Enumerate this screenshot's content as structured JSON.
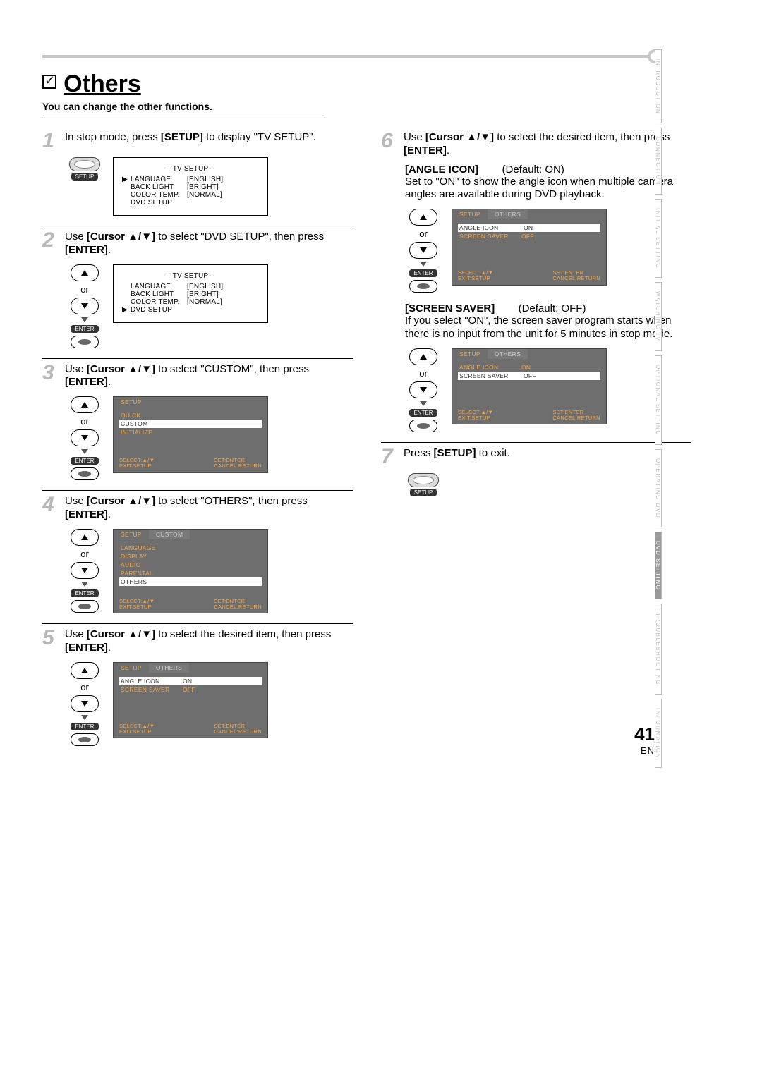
{
  "page": {
    "number": "41",
    "lang": "EN"
  },
  "title": "Others",
  "subtitle": "You can change the other functions.",
  "side_tabs": [
    "INTRODUCTION",
    "CONNECTION",
    "INITIAL SETTING",
    "WATCHING TV",
    "OPTIONAL SETTING",
    "OPERATING DVD",
    "DVD SETTING",
    "TROUBLESHOOTING",
    "INFORMATION"
  ],
  "active_tab_index": 6,
  "step1": {
    "text_before": "In stop mode, press ",
    "bold": "[SETUP]",
    "text_after": " to display \"TV SETUP\".",
    "panel_title": "–  TV SETUP  –",
    "rows": [
      {
        "ptr": "▶",
        "lab": "LANGUAGE",
        "val": "[ENGLISH]"
      },
      {
        "ptr": "",
        "lab": "BACK LIGHT",
        "val": "[BRIGHT]"
      },
      {
        "ptr": "",
        "lab": "COLOR TEMP.",
        "val": "[NORMAL]"
      },
      {
        "ptr": "",
        "lab": "DVD SETUP",
        "val": ""
      }
    ],
    "btn": "SETUP"
  },
  "step2": {
    "text_before": "Use ",
    "bold1": "[Cursor ▲/▼]",
    "text_mid": " to select \"DVD SETUP\", then press ",
    "bold2": "[ENTER]",
    "text_after": ".",
    "panel_title": "–  TV SETUP  –",
    "rows": [
      {
        "ptr": "",
        "lab": "LANGUAGE",
        "val": "[ENGLISH]"
      },
      {
        "ptr": "",
        "lab": "BACK LIGHT",
        "val": "[BRIGHT]"
      },
      {
        "ptr": "",
        "lab": "COLOR TEMP.",
        "val": "[NORMAL]"
      },
      {
        "ptr": "▶",
        "lab": "DVD SETUP",
        "val": ""
      }
    ]
  },
  "step3": {
    "text_before": "Use ",
    "bold1": "[Cursor ▲/▼]",
    "text_mid": " to select \"CUSTOM\", then press ",
    "bold2": "[ENTER]",
    "text_after": ".",
    "tab": "SETUP",
    "rows": [
      {
        "lab": "QUICK",
        "hl": false
      },
      {
        "lab": "CUSTOM",
        "hl": true
      },
      {
        "lab": "INITIALIZE",
        "hl": false
      }
    ]
  },
  "step4": {
    "text_before": "Use ",
    "bold1": "[Cursor ▲/▼]",
    "text_mid": " to select \"OTHERS\", then press ",
    "bold2": "[ENTER]",
    "text_after": ".",
    "tab1": "SETUP",
    "tab2": "CUSTOM",
    "rows": [
      {
        "lab": "LANGUAGE",
        "hl": false
      },
      {
        "lab": "DISPLAY",
        "hl": false
      },
      {
        "lab": "AUDIO",
        "hl": false
      },
      {
        "lab": "PARENTAL",
        "hl": false
      },
      {
        "lab": "OTHERS",
        "hl": true
      }
    ]
  },
  "step5": {
    "text_before": "Use ",
    "bold1": "[Cursor ▲/▼]",
    "text_mid": " to select the desired item, then press ",
    "bold2": "[ENTER]",
    "text_after": ".",
    "tab1": "SETUP",
    "tab2": "OTHERS",
    "rows": [
      {
        "lab": "ANGLE ICON",
        "val": "ON",
        "hl": true
      },
      {
        "lab": "SCREEN SAVER",
        "val": "OFF",
        "hl": false
      }
    ]
  },
  "step6": {
    "text_before": "Use ",
    "bold1": "[Cursor ▲/▼]",
    "text_mid": " to select the desired item, then press ",
    "bold2": "[ENTER]",
    "text_after": ".",
    "angle": {
      "head_bold": "[ANGLE ICON]",
      "head_def": "(Default: ON)",
      "desc": "Set to \"ON\" to show the angle icon when multiple camera angles are available during DVD playback.",
      "tab1": "SETUP",
      "tab2": "OTHERS",
      "rows": [
        {
          "lab": "ANGLE ICON",
          "val": "ON",
          "hlval": true
        },
        {
          "lab": "SCREEN SAVER",
          "val": "OFF",
          "hlval": false
        }
      ]
    },
    "saver": {
      "head_bold": "[SCREEN SAVER]",
      "head_def": "(Default: OFF)",
      "desc": "If you select \"ON\", the screen saver program starts when there is no input from the unit for 5 minutes in stop mode.",
      "tab1": "SETUP",
      "tab2": "OTHERS",
      "rows": [
        {
          "lab": "ANGLE ICON",
          "val": "ON",
          "hlval": false
        },
        {
          "lab": "SCREEN SAVER",
          "val": "OFF",
          "hlval": true
        }
      ]
    }
  },
  "step7": {
    "text_before": "Press ",
    "bold": "[SETUP]",
    "text_after": " to exit.",
    "btn": "SETUP"
  },
  "remote": {
    "or": "or",
    "enter": "ENTER"
  },
  "panel_foot": {
    "l1": "SELECT:▲/▼",
    "l2": "EXIT:SETUP",
    "r1": "SET:ENTER",
    "r2": "CANCEL:RETURN"
  }
}
